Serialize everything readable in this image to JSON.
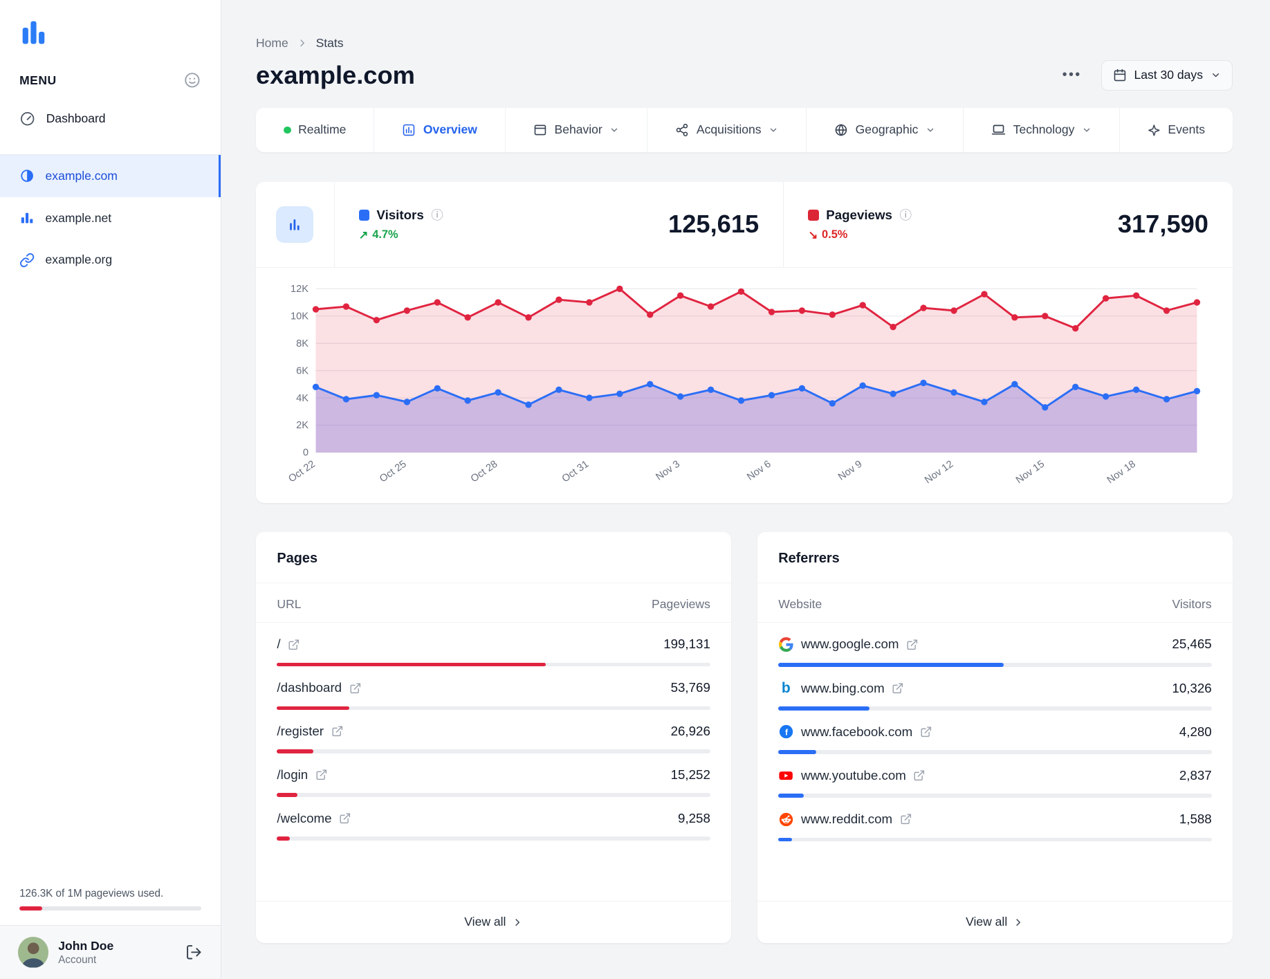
{
  "colors": {
    "blue": "#2b6ef6",
    "red": "#e02440",
    "green": "#16a34a"
  },
  "sidebar": {
    "menu_label": "MENU",
    "dashboard": "Dashboard",
    "sites": [
      {
        "label": "example.com",
        "icon": "contrast-icon",
        "active": true
      },
      {
        "label": "example.net",
        "icon": "bar-chart-icon",
        "active": false
      },
      {
        "label": "example.org",
        "icon": "link-icon",
        "active": false
      }
    ],
    "usage_text": "126.3K of 1M pageviews used.",
    "usage_pct": 12.6,
    "user_name": "John Doe",
    "user_role": "Account"
  },
  "header": {
    "breadcrumb_home": "Home",
    "breadcrumb_current": "Stats",
    "title": "example.com",
    "more_label": "•••",
    "date_range": "Last 30 days"
  },
  "tabs": {
    "realtime": "Realtime",
    "overview": "Overview",
    "behavior": "Behavior",
    "acquisitions": "Acquisitions",
    "geographic": "Geographic",
    "technology": "Technology",
    "events": "Events"
  },
  "stats": {
    "visitors_label": "Visitors",
    "visitors_value": "125,615",
    "visitors_change": "4.7%",
    "visitors_change_dir": "up",
    "pageviews_label": "Pageviews",
    "pageviews_value": "317,590",
    "pageviews_change": "0.5%",
    "pageviews_change_dir": "down"
  },
  "chart_data": {
    "type": "line",
    "x_ticks": [
      "Oct 22",
      "Oct 25",
      "Oct 28",
      "Oct 31",
      "Nov 3",
      "Nov 6",
      "Nov 9",
      "Nov 12",
      "Nov 15",
      "Nov 18"
    ],
    "points_per_tick": 3,
    "y_ticks": [
      "0",
      "2K",
      "4K",
      "6K",
      "8K",
      "10K",
      "12K"
    ],
    "ylim": [
      0,
      12000
    ],
    "grid": true,
    "series": [
      {
        "name": "Pageviews",
        "color": "#e02440",
        "fill": "rgba(224,36,64,0.14)",
        "values": [
          10500,
          10700,
          9700,
          10400,
          11000,
          9900,
          11000,
          9900,
          11200,
          11000,
          12000,
          10100,
          11500,
          10700,
          11800,
          10300,
          10400,
          10100,
          10800,
          9200,
          10600,
          10400,
          11600,
          9900,
          10000,
          9100,
          11300,
          11500,
          10400,
          11000
        ]
      },
      {
        "name": "Visitors",
        "color": "#2b6ef6",
        "fill": "rgba(86,82,222,0.28)",
        "values": [
          4800,
          3900,
          4200,
          3700,
          4700,
          3800,
          4400,
          3500,
          4600,
          4000,
          4300,
          5000,
          4100,
          4600,
          3800,
          4200,
          4700,
          3600,
          4900,
          4300,
          5100,
          4400,
          3700,
          5000,
          3300,
          4800,
          4100,
          4600,
          3900,
          4500
        ]
      }
    ]
  },
  "pages": {
    "title": "Pages",
    "columns": [
      "URL",
      "Pageviews"
    ],
    "rows": [
      {
        "label": "/",
        "value": "199,131",
        "num": 199131
      },
      {
        "label": "/dashboard",
        "value": "53,769",
        "num": 53769
      },
      {
        "label": "/register",
        "value": "26,926",
        "num": 26926
      },
      {
        "label": "/login",
        "value": "15,252",
        "num": 15252
      },
      {
        "label": "/welcome",
        "value": "9,258",
        "num": 9258
      }
    ],
    "view_all": "View all"
  },
  "referrers": {
    "title": "Referrers",
    "columns": [
      "Website",
      "Visitors"
    ],
    "rows": [
      {
        "label": "www.google.com",
        "value": "25,465",
        "num": 25465,
        "icon": "google-icon"
      },
      {
        "label": "www.bing.com",
        "value": "10,326",
        "num": 10326,
        "icon": "bing-icon"
      },
      {
        "label": "www.facebook.com",
        "value": "4,280",
        "num": 4280,
        "icon": "facebook-icon"
      },
      {
        "label": "www.youtube.com",
        "value": "2,837",
        "num": 2837,
        "icon": "youtube-icon"
      },
      {
        "label": "www.reddit.com",
        "value": "1,588",
        "num": 1588,
        "icon": "reddit-icon"
      }
    ],
    "view_all": "View all"
  }
}
